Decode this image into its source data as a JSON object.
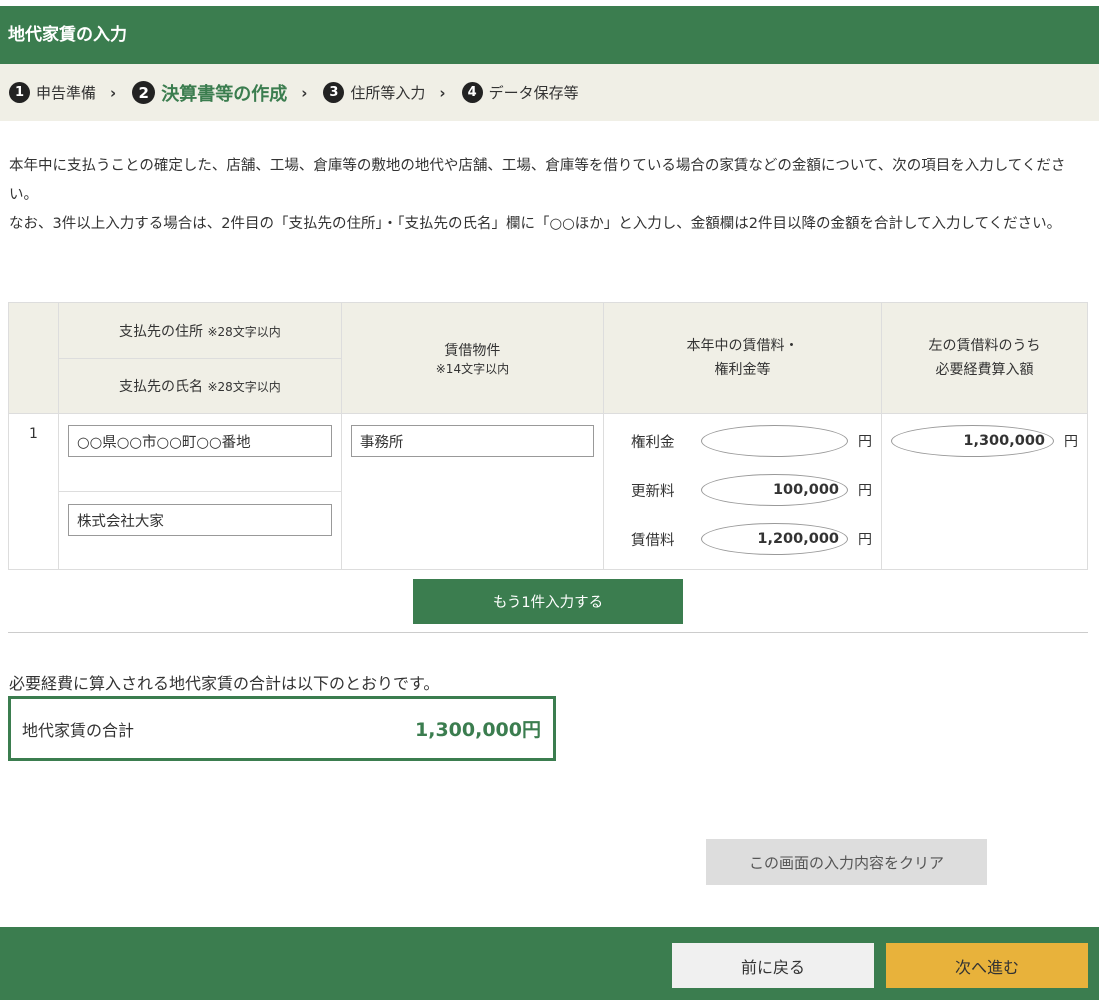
{
  "header": {
    "title": "地代家賃の入力"
  },
  "steps": [
    {
      "num": "1",
      "label": "申告準備"
    },
    {
      "num": "2",
      "label": "決算書等の作成"
    },
    {
      "num": "3",
      "label": "住所等入力"
    },
    {
      "num": "4",
      "label": "データ保存等"
    }
  ],
  "intro": {
    "line1": "本年中に支払うことの確定した、店舗、工場、倉庫等の敷地の地代や店舗、工場、倉庫等を借りている場合の家賃などの金額について、次の項目を入力してください。",
    "line2": "なお、3件以上入力する場合は、2件目の「支払先の住所」・「支払先の氏名」欄に「○○ほか」と入力し、金額欄は2件目以降の金額を合計して入力してください。"
  },
  "table": {
    "col_address": "支払先の住所",
    "col_address_note": "※28文字以内",
    "col_name": "支払先の氏名",
    "col_name_note": "※28文字以内",
    "col_property": "賃借物件",
    "col_property_note": "※14文字以内",
    "col_rent_line1": "本年中の賃借料・",
    "col_rent_line2": "権利金等",
    "col_expense_line1": "左の賃借料のうち",
    "col_expense_line2": "必要経費算入額",
    "row": {
      "index": "1",
      "address": "○○県○○市○○町○○番地",
      "name": "株式会社大家",
      "property": "事務所",
      "key_money_label": "権利金",
      "key_money": "",
      "renewal_label": "更新料",
      "renewal": "100,000",
      "rent_label": "賃借料",
      "rent": "1,200,000",
      "expense": "1,300,000",
      "yen": "円"
    }
  },
  "add_button": "もう1件入力する",
  "summary": {
    "text": "必要経費に算入される地代家賃の合計は以下のとおりです。",
    "label": "地代家賃の合計",
    "value": "1,300,000円"
  },
  "clear_button": "この画面の入力内容をクリア",
  "back_button": "前に戻る",
  "next_button": "次へ進む",
  "colors": {
    "accent": "#3b7d4f",
    "next": "#e8b23b",
    "step_bg": "#f0efe6"
  }
}
